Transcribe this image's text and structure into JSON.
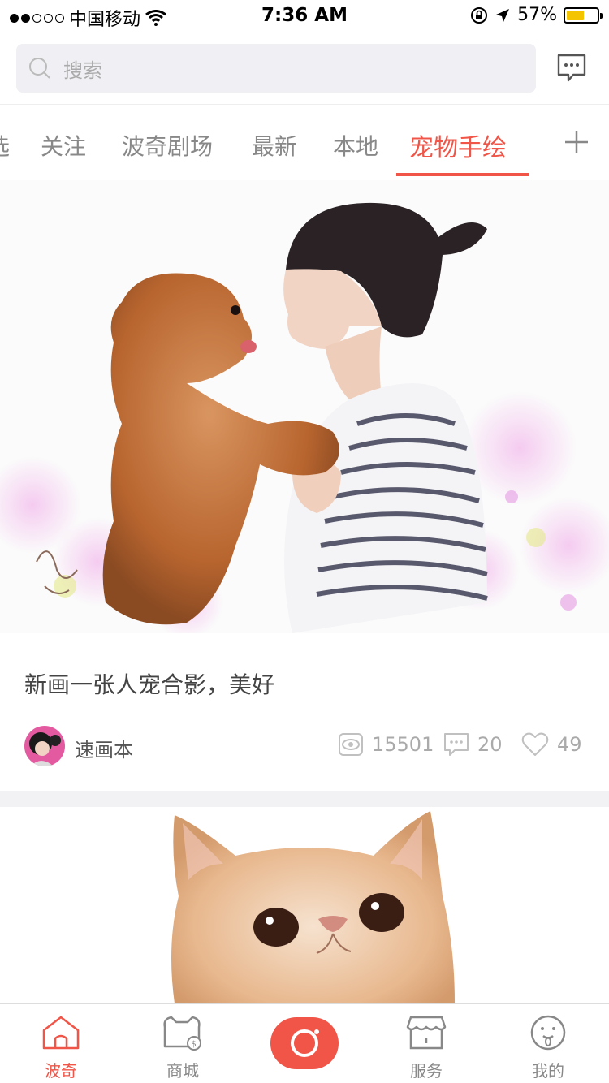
{
  "status_bar": {
    "carrier": "中国移动",
    "time": "7:36 AM",
    "battery": "57%"
  },
  "search": {
    "placeholder": "搜索"
  },
  "tabs": [
    {
      "label": "选"
    },
    {
      "label": "关注"
    },
    {
      "label": "波奇剧场"
    },
    {
      "label": "最新"
    },
    {
      "label": "本地"
    },
    {
      "label": "宠物手绘",
      "active": true
    }
  ],
  "post": {
    "title": "新画一张人宠合影，美好",
    "author": "速画本",
    "views": "15501",
    "comments": "20",
    "likes": "49"
  },
  "bottom_nav": {
    "items": [
      {
        "label": "波奇",
        "icon": "home-icon",
        "active": true
      },
      {
        "label": "商城",
        "icon": "shop-bag-icon"
      },
      {
        "label": "",
        "icon": "camera-icon"
      },
      {
        "label": "服务",
        "icon": "store-icon"
      },
      {
        "label": "我的",
        "icon": "profile-icon"
      }
    ]
  },
  "colors": {
    "accent": "#f05548",
    "battery": "#f5c400"
  }
}
